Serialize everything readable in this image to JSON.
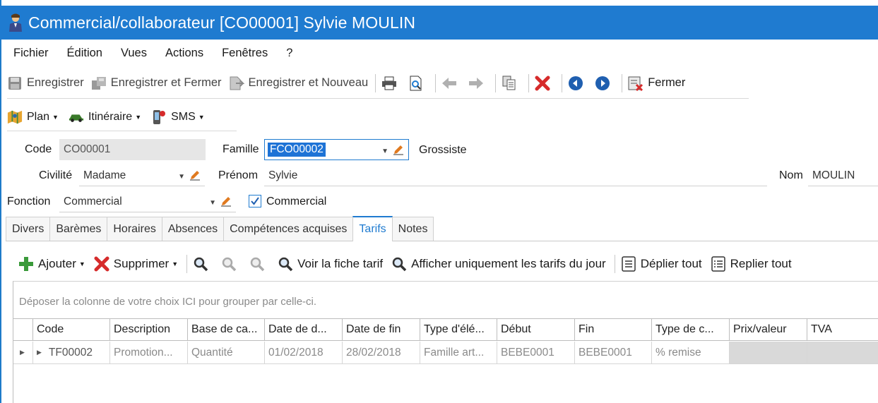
{
  "window": {
    "title": "Commercial/collaborateur [CO00001] Sylvie MOULIN"
  },
  "menu": [
    "Fichier",
    "Édition",
    "Vues",
    "Actions",
    "Fenêtres",
    "?"
  ],
  "toolbar": {
    "save": "Enregistrer",
    "save_close": "Enregistrer et Fermer",
    "save_new": "Enregistrer et Nouveau",
    "close": "Fermer"
  },
  "toolbar2": {
    "plan": "Plan",
    "itineraire": "Itinéraire",
    "sms": "SMS"
  },
  "form": {
    "code_label": "Code",
    "code_value": "CO00001",
    "famille_label": "Famille",
    "famille_value": "FCO00002",
    "famille_desc": "Grossiste",
    "civilite_label": "Civilité",
    "civilite_value": "Madame",
    "prenom_label": "Prénom",
    "prenom_value": "Sylvie",
    "nom_label": "Nom",
    "nom_value": "MOULIN",
    "fonction_label": "Fonction",
    "fonction_value": "Commercial",
    "commercial_checkbox_label": "Commercial",
    "commercial_checked": true
  },
  "tabs": [
    "Divers",
    "Barèmes",
    "Horaires",
    "Absences",
    "Compétences acquises",
    "Tarifs",
    "Notes"
  ],
  "active_tab": "Tarifs",
  "tarifs_toolbar": {
    "add": "Ajouter",
    "delete": "Supprimer",
    "view_sheet": "Voir la fiche tarif",
    "show_today": "Afficher uniquement les tarifs du jour",
    "expand_all": "Déplier tout",
    "collapse_all": "Replier tout"
  },
  "grid": {
    "group_hint": "Déposer la colonne de votre choix ICI pour grouper par celle-ci.",
    "columns": [
      "Code",
      "Description",
      "Base de ca...",
      "Date de d...",
      "Date de fin",
      "Type d'élé...",
      "Début",
      "Fin",
      "Type de c...",
      "Prix/valeur",
      "TVA"
    ],
    "rows": [
      [
        "TF00002",
        "Promotion...",
        "Quantité",
        "01/02/2018",
        "28/02/2018",
        "Famille art...",
        "BEBE0001",
        "BEBE0001",
        "% remise",
        "",
        ""
      ]
    ]
  },
  "colors": {
    "accent": "#1f7bd0",
    "delete_red": "#d62b2b",
    "add_green": "#3a9a3a"
  }
}
